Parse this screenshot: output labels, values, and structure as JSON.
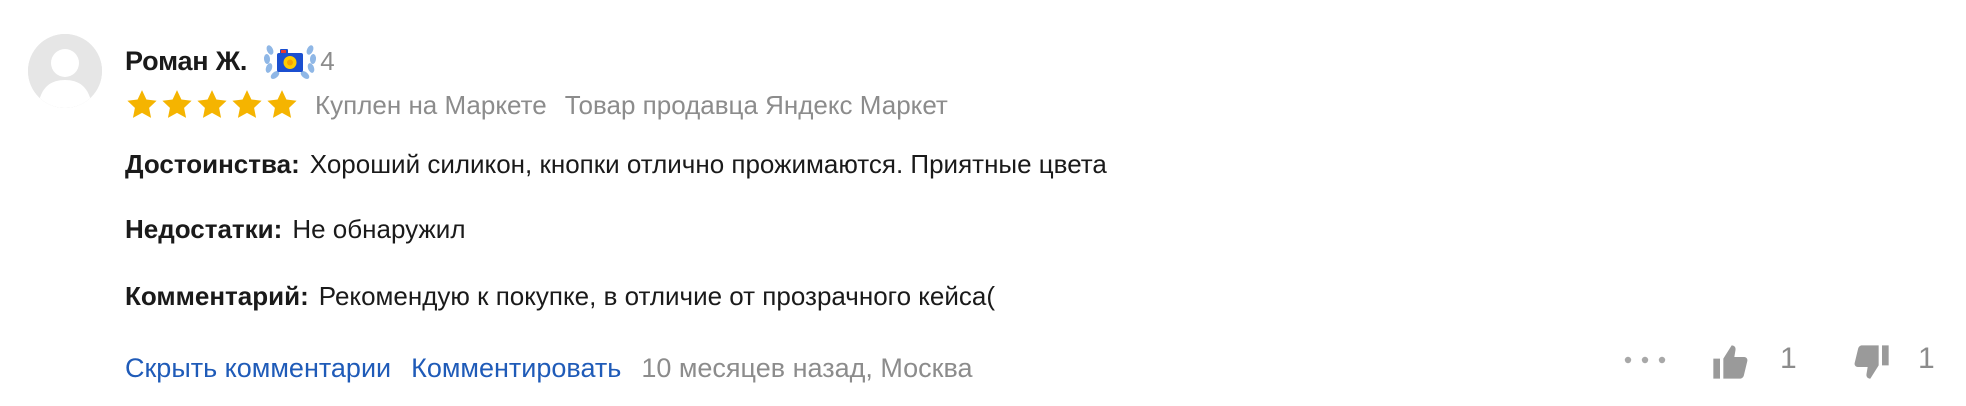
{
  "review": {
    "author": {
      "name": "Роман Ж.",
      "badge_icon": "camera-laurel-badge-icon",
      "badge_count": "4"
    },
    "rating": 5,
    "bought_label": "Куплен на Маркете",
    "seller_label": "Товар продавца Яндекс Маркет",
    "pros": {
      "label": "Достоинства:",
      "text": "Хороший силикон, кнопки отлично прожимаются. Приятные цвета"
    },
    "cons": {
      "label": "Недостатки:",
      "text": "Не обнаружил"
    },
    "comment": {
      "label": "Комментарий:",
      "text": "Рекомендую к покупке, в отличие от прозрачного кейса("
    },
    "footer": {
      "hide_comments": "Скрыть комментарии",
      "add_comment": "Комментировать",
      "date_location": "10 месяцев назад, Москва"
    },
    "votes": {
      "likes": "1",
      "dislikes": "1"
    }
  },
  "colors": {
    "star": "#f5b400",
    "link": "#1f5bb8",
    "muted": "#8c8c8c",
    "text": "#1a1a1a",
    "icon": "#9a9a9a"
  }
}
